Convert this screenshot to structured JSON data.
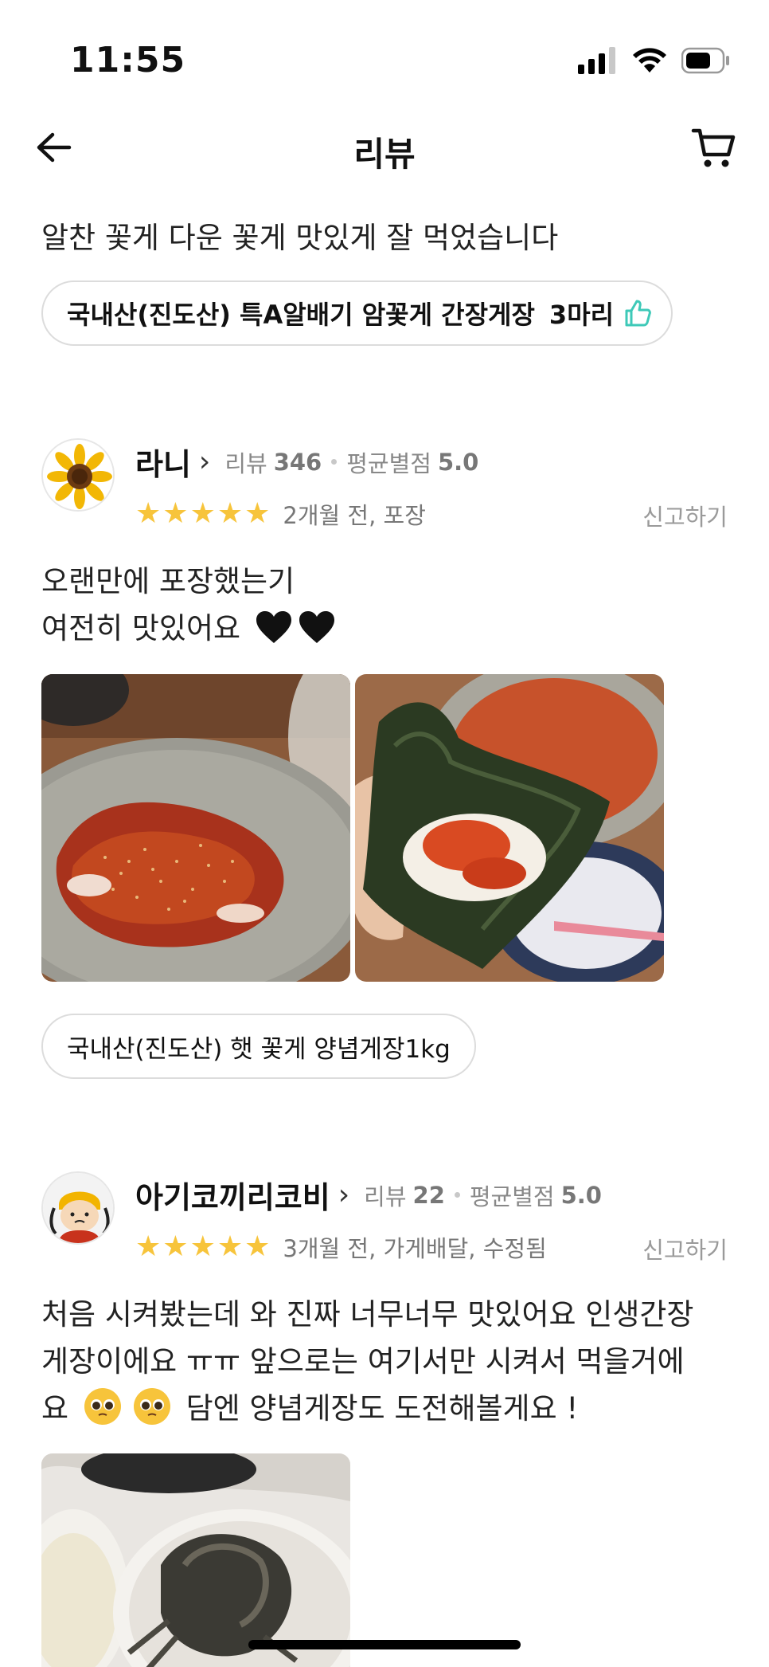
{
  "status": {
    "time": "11:55"
  },
  "header": {
    "title": "리뷰"
  },
  "top": {
    "review_text": "알찬 꽃게 다운 꽃게 맛있게 잘 먹었습니다",
    "product_name": "국내산(진도산) 특A알배기 암꽃게 간장게장",
    "product_qty": "3마리"
  },
  "reviews": [
    {
      "name": "라니",
      "review_label": "리뷰",
      "review_count": "346",
      "avg_label": "평균별점",
      "avg_value": "5.0",
      "stars": 5,
      "date": "2개월 전, 포장",
      "report": "신고하기",
      "body_line1": "오랜만에 포장했는기",
      "body_line2": "여전히 맛있어요",
      "product": "국내산(진도산) 햇 꽃게 양념게장1kg"
    },
    {
      "name": "아기코끼리코비",
      "review_label": "리뷰",
      "review_count": "22",
      "avg_label": "평균별점",
      "avg_value": "5.0",
      "stars": 5,
      "date": "3개월 전, 가게배달, 수정됨",
      "report": "신고하기",
      "body_line1": "처음 시켜봤는데 와 진짜 너무너무 맛있어요 인생간장",
      "body_line2": "게장이에요 ㅠㅠ 앞으로는 여기서만 시켜서 먹을거에",
      "body_line3_a": "요",
      "body_line3_b": "담엔 양념게장도 도전해볼게요 !"
    }
  ],
  "colors": {
    "star": "#f7c43b",
    "thumb": "#3ec9b8",
    "meta": "#888888"
  }
}
